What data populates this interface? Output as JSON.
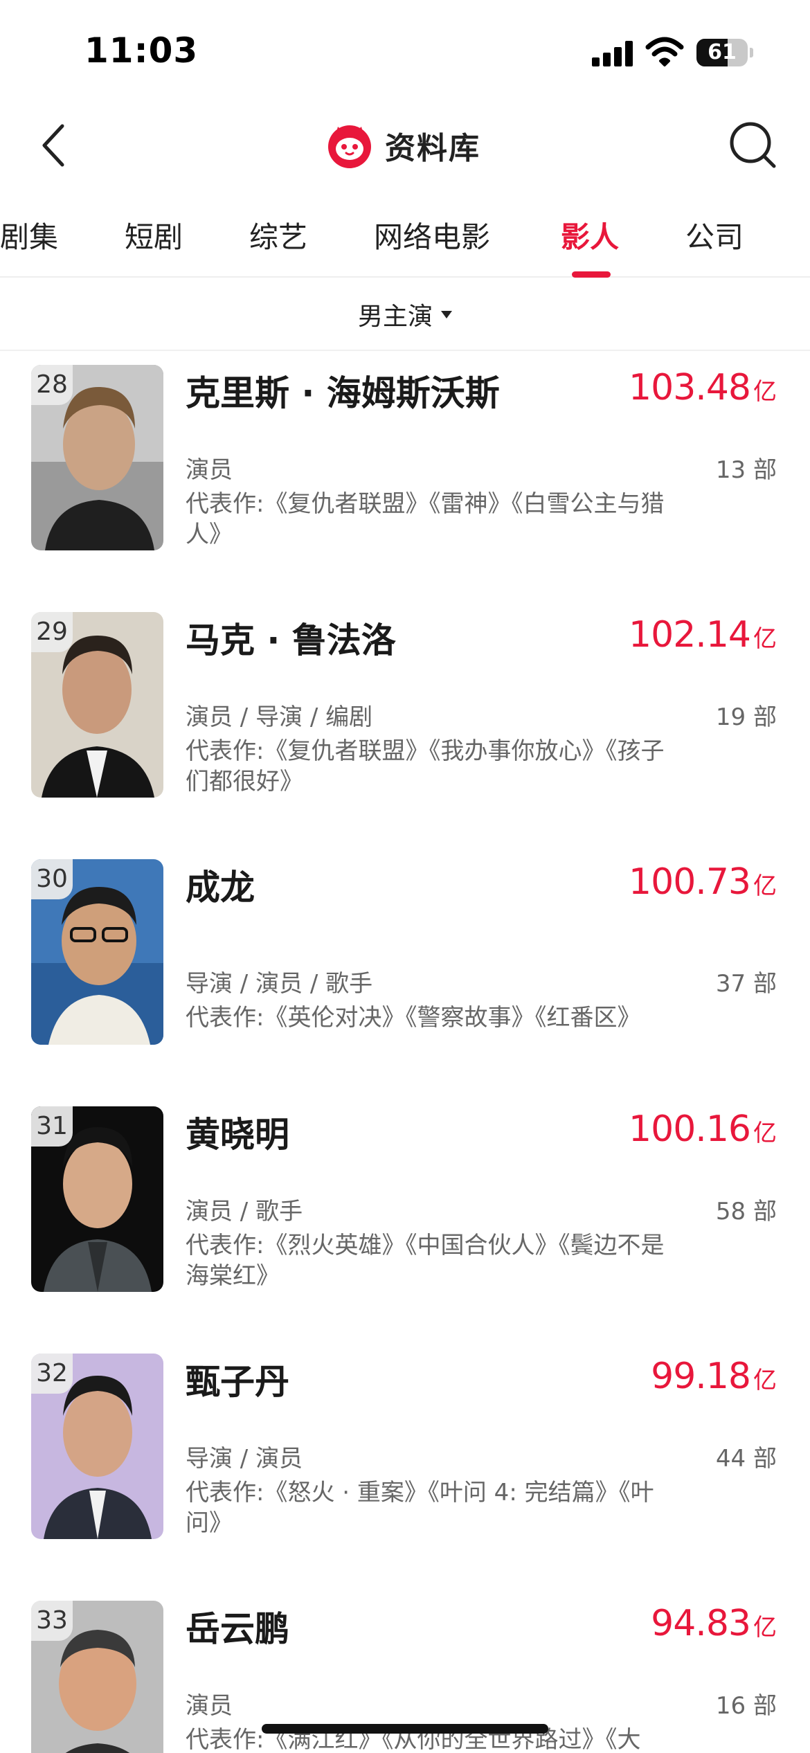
{
  "status_bar": {
    "time": "11:03",
    "battery": "61",
    "battery_level": 0.61
  },
  "nav": {
    "title": "资料库",
    "back_icon": "chevron-left-icon",
    "search_icon": "search-icon",
    "logo_icon": "cat-logo-icon",
    "accent_color": "#e8173b"
  },
  "tabs": [
    {
      "label": "剧集"
    },
    {
      "label": "短剧"
    },
    {
      "label": "综艺"
    },
    {
      "label": "网络电影"
    },
    {
      "label": "影人",
      "active": true
    },
    {
      "label": "公司"
    }
  ],
  "filter": {
    "label": "男主演"
  },
  "people": [
    {
      "rank": "28",
      "name": "克里斯 · 海姆斯沃斯",
      "box_office": "103.48",
      "unit": "亿",
      "roles": "演员",
      "works": "13 部",
      "rep": "代表作:《复仇者联盟》《雷神》《白雪公主与猎人》"
    },
    {
      "rank": "29",
      "name": "马克 · 鲁法洛",
      "box_office": "102.14",
      "unit": "亿",
      "roles": "演员 / 导演 / 编剧",
      "works": "19 部",
      "rep": "代表作:《复仇者联盟》《我办事你放心》《孩子们都很好》"
    },
    {
      "rank": "30",
      "name": "成龙",
      "box_office": "100.73",
      "unit": "亿",
      "roles": "导演 / 演员 / 歌手",
      "works": "37 部",
      "rep": "代表作:《英伦对决》《警察故事》《红番区》"
    },
    {
      "rank": "31",
      "name": "黄晓明",
      "box_office": "100.16",
      "unit": "亿",
      "roles": "演员 / 歌手",
      "works": "58 部",
      "rep": "代表作:《烈火英雄》《中国合伙人》《鬓边不是海棠红》"
    },
    {
      "rank": "32",
      "name": "甄子丹",
      "box_office": "99.18",
      "unit": "亿",
      "roles": "导演 / 演员",
      "works": "44 部",
      "rep": "代表作:《怒火 · 重案》《叶问 4: 完结篇》《叶问》"
    },
    {
      "rank": "33",
      "name": "岳云鹏",
      "box_office": "94.83",
      "unit": "亿",
      "roles": "演员",
      "works": "16 部",
      "rep": "代表作:《满江红》《从你的全世界路过》《大"
    }
  ]
}
